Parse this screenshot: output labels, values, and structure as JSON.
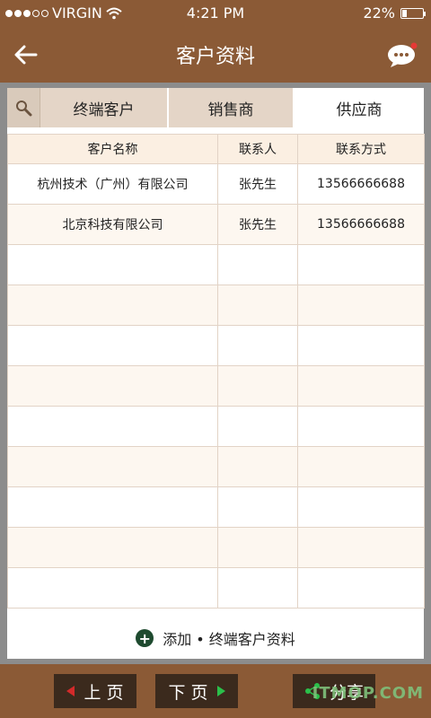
{
  "status": {
    "carrier": "VIRGIN",
    "time": "4:21 PM",
    "battery": "22%",
    "battery_level": 0.22
  },
  "nav": {
    "title": "客户资料",
    "back_icon": "arrow-left-icon",
    "chat_icon": "chat-bubble-icon",
    "notification_color": "#e53935"
  },
  "tabs": {
    "search_icon": "search-icon",
    "items": [
      "终端客户",
      "销售商",
      "供应商"
    ],
    "active_index": 2
  },
  "table": {
    "headers": [
      "客户名称",
      "联系人",
      "联系方式"
    ],
    "rows": [
      [
        "杭州技术（广州）有限公司",
        "张先生",
        "13566666688"
      ],
      [
        "北京科技有限公司",
        "张先生",
        "13566666688"
      ],
      [
        "",
        "",
        ""
      ],
      [
        "",
        "",
        ""
      ],
      [
        "",
        "",
        ""
      ],
      [
        "",
        "",
        ""
      ],
      [
        "",
        "",
        ""
      ],
      [
        "",
        "",
        ""
      ],
      [
        "",
        "",
        ""
      ],
      [
        "",
        "",
        ""
      ],
      [
        "",
        "",
        ""
      ]
    ]
  },
  "add": {
    "icon": "plus-circle-icon",
    "label": "添加 • 终端客户资料"
  },
  "bottom": {
    "prev": "上 页",
    "next": "下 页",
    "share": "分享"
  },
  "watermark": "ITMOP.COM",
  "colors": {
    "brand_brown": "#8b5a36",
    "tab_bg": "#e4d5c7",
    "header_bg": "#fbefe2",
    "button_dark": "#3b2a1d",
    "add_icon": "#1e4a2f"
  }
}
